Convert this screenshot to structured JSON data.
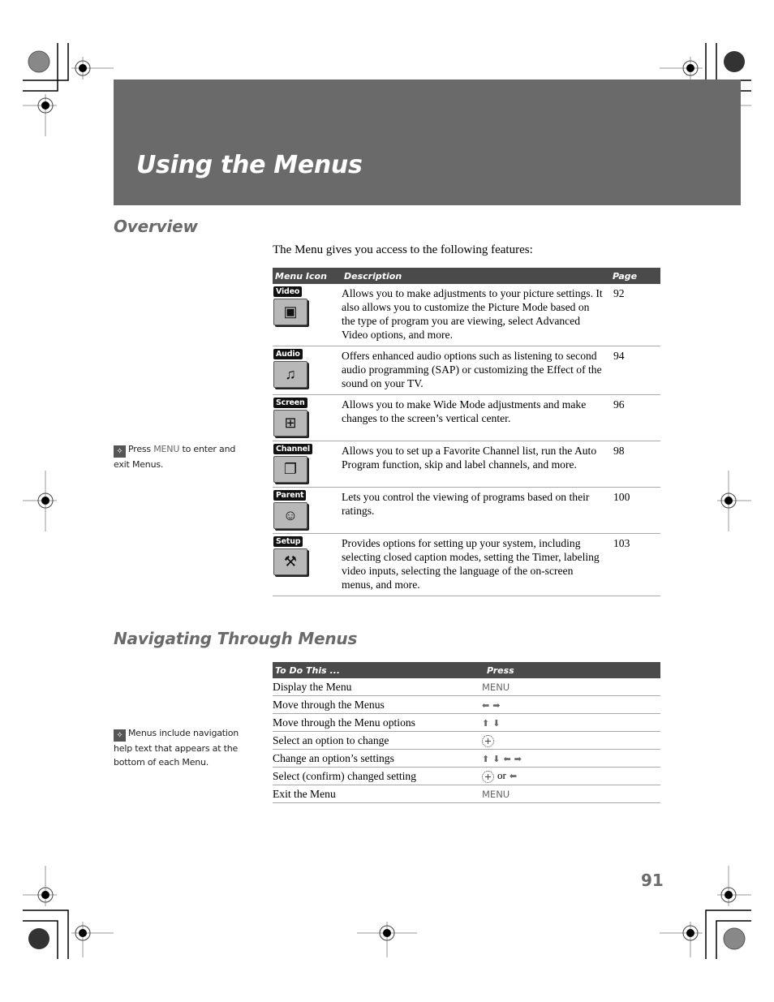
{
  "banner": {
    "title": "Using the Menus"
  },
  "overview": {
    "heading": "Overview",
    "intro": "The Menu gives you access to the following features:",
    "columns": [
      "Menu Icon",
      "Description",
      "Page"
    ],
    "rows": [
      {
        "icon_label": "Video",
        "icon": "video-icon",
        "description": "Allows you to make adjustments to your picture settings. It also allows you to customize the Picture Mode based on the type of program you are viewing, select Advanced Video options, and more.",
        "page": "92"
      },
      {
        "icon_label": "Audio",
        "icon": "audio-icon",
        "description": "Offers enhanced audio options such as listening to second audio programming (SAP) or customizing the Effect of the sound on your TV.",
        "page": "94"
      },
      {
        "icon_label": "Screen",
        "icon": "screen-icon",
        "description": "Allows you to make Wide Mode adjustments and make changes to the screen’s vertical center.",
        "page": "96"
      },
      {
        "icon_label": "Channel",
        "icon": "channel-icon",
        "description": "Allows you to set up a Favorite Channel list, run the Auto Program function, skip and label channels, and more.",
        "page": "98"
      },
      {
        "icon_label": "Parent",
        "icon": "parent-icon",
        "description": "Lets you control the viewing of programs based on their ratings.",
        "page": "100"
      },
      {
        "icon_label": "Setup",
        "icon": "setup-icon",
        "description": "Provides options for  setting up your system, including selecting closed caption modes, setting the Timer, labeling video inputs, selecting the language of the on-screen menus, and more.",
        "page": "103"
      }
    ],
    "tip": {
      "icon": "lightbulb-icon",
      "pre": "Press ",
      "keyword": "MENU",
      "post": " to enter and exit Menus."
    }
  },
  "navigating": {
    "heading": "Navigating Through Menus",
    "columns": [
      "To Do This ...",
      "Press"
    ],
    "rows": [
      {
        "action": "Display the Menu",
        "press": "MENU"
      },
      {
        "action": "Move through the Menus",
        "press": "← →"
      },
      {
        "action": "Move through the Menu options",
        "press": "↑ ↓"
      },
      {
        "action": "Select an option to change",
        "press": "joystick"
      },
      {
        "action": "Change an option’s settings",
        "press": "↑ ↓ ← →"
      },
      {
        "action": "Select (confirm) changed setting",
        "press": "joystick",
        "or_text": "or",
        "press_alt": "←"
      },
      {
        "action": "Exit the Menu",
        "press": "MENU"
      }
    ],
    "tip": {
      "icon": "lightbulb-icon",
      "text": "Menus include navigation help text that appears at the bottom of each Menu."
    }
  },
  "footer": {
    "page_number": "91"
  },
  "colors": {
    "banner": "#6a6a6a",
    "table_header": "#4a4a4a",
    "heading": "#6a6a6a"
  }
}
